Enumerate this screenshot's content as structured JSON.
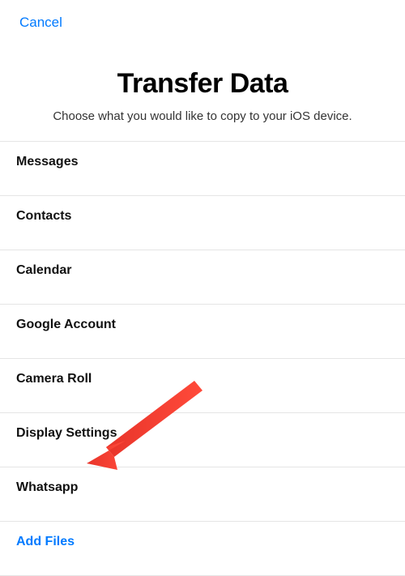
{
  "header": {
    "cancel_label": "Cancel"
  },
  "title_block": {
    "title": "Transfer Data",
    "subtitle": "Choose what you would like to copy to your iOS device."
  },
  "list": {
    "items": [
      {
        "label": "Messages"
      },
      {
        "label": "Contacts"
      },
      {
        "label": "Calendar"
      },
      {
        "label": "Google Account"
      },
      {
        "label": "Camera Roll"
      },
      {
        "label": "Display Settings"
      },
      {
        "label": "Whatsapp"
      }
    ],
    "add_files_label": "Add Files"
  }
}
